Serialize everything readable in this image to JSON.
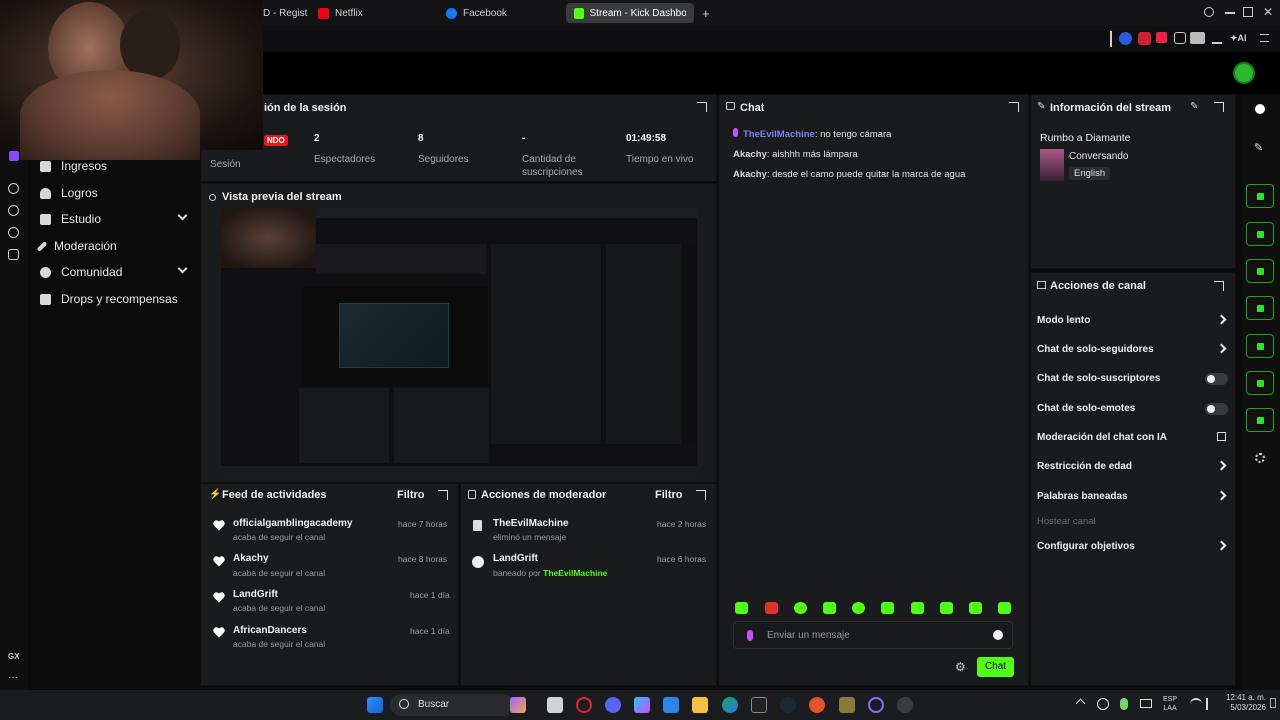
{
  "browser": {
    "tabs": [
      {
        "label": "D - Regist",
        "active": false
      },
      {
        "label": "Netflix",
        "active": false
      },
      {
        "label": "Facebook",
        "active": false
      },
      {
        "label": "Stream - Kick Dashboard",
        "active": true
      }
    ],
    "new_tab_label": "+"
  },
  "session": {
    "title": "ión de la sesión",
    "live_badge": "NDO",
    "session_label": "Sesión",
    "stats": [
      {
        "value": "2",
        "label": "Espectadores"
      },
      {
        "value": "8",
        "label": "Seguidores"
      },
      {
        "value": "-",
        "label": "Cantidad de suscripciones"
      },
      {
        "value": "01:49:58",
        "label": "Tiempo en vivo"
      }
    ]
  },
  "sidebar": {
    "items": [
      {
        "label": "Ingresos",
        "icon": "cash-icon",
        "expandable": false
      },
      {
        "label": "Logros",
        "icon": "trophy-icon",
        "expandable": false
      },
      {
        "label": "Estudio",
        "icon": "studio-icon",
        "expandable": true
      },
      {
        "label": "Moderación",
        "icon": "wrench-icon",
        "expandable": false
      },
      {
        "label": "Comunidad",
        "icon": "people-icon",
        "expandable": true
      },
      {
        "label": "Drops y recompensas",
        "icon": "gift-icon",
        "expandable": false
      }
    ]
  },
  "preview": {
    "title": "Vista previa del stream"
  },
  "feed": {
    "title": "Feed de actividades",
    "filter": "Filtro",
    "items": [
      {
        "name": "officialgamblingacademy",
        "sub": "acaba de seguir el canal",
        "time": "hace 7 horas"
      },
      {
        "name": "Akachy",
        "sub": "acaba de seguir el canal",
        "time": "hace 8 horas"
      },
      {
        "name": "LandGrift",
        "sub": "acaba de seguir el canal",
        "time": "hace 1 día"
      },
      {
        "name": "AfricanDancers",
        "sub": "acaba de seguir el canal",
        "time": "hace 1 día"
      }
    ]
  },
  "modactions": {
    "title": "Acciones de moderador",
    "filter": "Filtro",
    "items": [
      {
        "name": "TheEvilMachine",
        "sub": "eliminó un mensaje",
        "sub_user": "",
        "time": "hace 2 horas",
        "icon": "trash-icon"
      },
      {
        "name": "LandGrift",
        "sub": "baneado por",
        "sub_user": "TheEvilMachine",
        "time": "hace 6 horas",
        "icon": "ban-icon"
      }
    ]
  },
  "chat": {
    "title": "Chat",
    "messages": [
      {
        "user": "TheEvilMachine",
        "text": "no tengo cámara",
        "user_color": "#7f7cff"
      },
      {
        "user": "Akachy",
        "text": "aishhh más lámpara",
        "user_color": "#d8d8d8"
      },
      {
        "user": "Akachy",
        "text": "desde el camo puede quitar la marca de agua",
        "user_color": "#d8d8d8"
      }
    ],
    "input_placeholder": "Enviar un mensaje",
    "send_label": "Chat",
    "accent": "#53fc18"
  },
  "streaminfo": {
    "title": "Información del stream",
    "stream_title": "Rumbo a Diamante",
    "category": "Conversando",
    "language": "English"
  },
  "channel_actions": {
    "title": "Acciones de canal",
    "items": [
      {
        "label": "Modo lento",
        "control": "arrow"
      },
      {
        "label": "Chat de solo-seguidores",
        "control": "arrow"
      },
      {
        "label": "Chat de solo-suscriptores",
        "control": "toggle"
      },
      {
        "label": "Chat de solo-emotes",
        "control": "toggle"
      },
      {
        "label": "Moderación del chat con IA",
        "control": "external"
      },
      {
        "label": "Restricción de edad",
        "control": "arrow"
      },
      {
        "label": "Palabras baneadas",
        "control": "arrow"
      },
      {
        "label": "Hostear canal",
        "control": "disabled"
      },
      {
        "label": "Configurar objetivos",
        "control": "arrow"
      }
    ]
  },
  "taskbar": {
    "search_label": "Buscar",
    "lang": "ESP",
    "lang2": "LAA",
    "time": "12:41 a. m.",
    "date": "5/03/2026"
  },
  "left_bottom": {
    "label": "GX"
  }
}
